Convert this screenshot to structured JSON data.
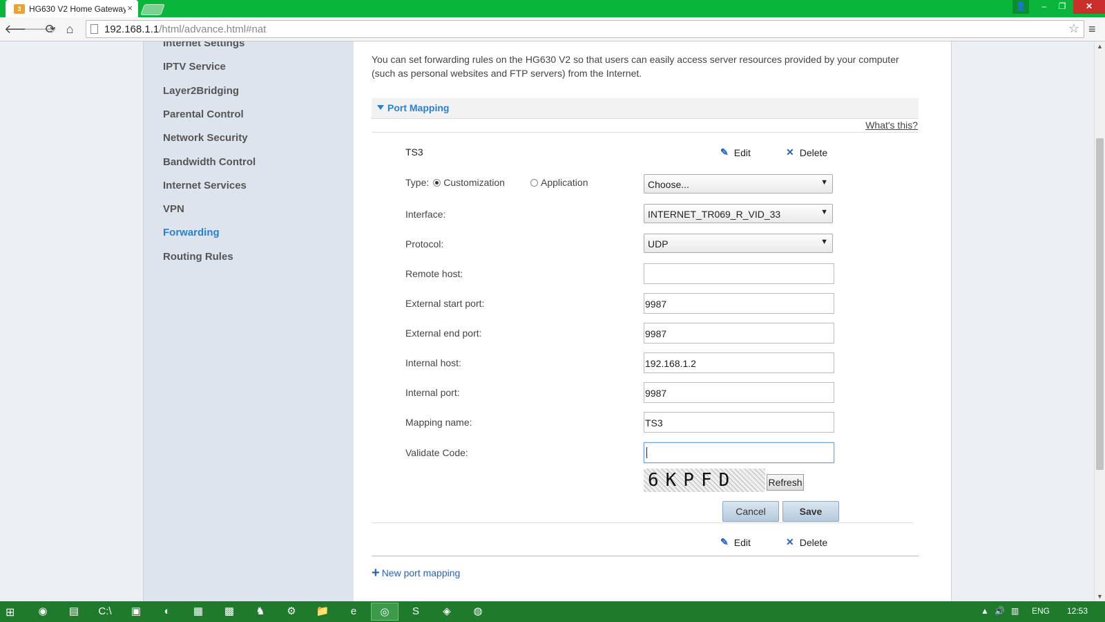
{
  "browser": {
    "tab_title": "HG630 V2 Home Gateway",
    "tab_close": "×",
    "favicon_text": "3",
    "url_host": "192.168.1.1",
    "url_path": "/html/advance.html#nat",
    "back_icon": "🡐",
    "forward_icon": "🡒",
    "reload_icon": "⟳",
    "home_icon": "⌂",
    "star_icon": "☆",
    "menu_icon": "≡",
    "win_user": "👤",
    "win_min": "–",
    "win_max": "❐",
    "win_close": "✕"
  },
  "sidebar": {
    "items": [
      {
        "label": "Internet Settings",
        "active": false
      },
      {
        "label": "IPTV Service",
        "active": false
      },
      {
        "label": "Layer2Bridging",
        "active": false
      },
      {
        "label": "Parental Control",
        "active": false
      },
      {
        "label": "Network Security",
        "active": false
      },
      {
        "label": "Bandwidth Control",
        "active": false
      },
      {
        "label": "Internet Services",
        "active": false
      },
      {
        "label": "VPN",
        "active": false
      },
      {
        "label": "Forwarding",
        "active": true
      },
      {
        "label": "Routing Rules",
        "active": false
      }
    ]
  },
  "main": {
    "intro": "You can set forwarding rules on the HG630 V2 so that users can easily access server resources provided by your computer (such as personal websites and FTP servers) from the Internet.",
    "section_title": "Port Mapping",
    "whats_this": "What's this?",
    "rule_name": "TS3",
    "edit_label": "Edit",
    "delete_label": "Delete",
    "edit_icon": "✎",
    "delete_icon": "✕",
    "form": {
      "type_label": "Type:",
      "type_customization": "Customization",
      "type_application": "Application",
      "type_selected": "Customization",
      "application_select": "Choose...",
      "interface_label": "Interface:",
      "interface_value": "INTERNET_TR069_R_VID_33",
      "protocol_label": "Protocol:",
      "protocol_value": "UDP",
      "remote_host_label": "Remote host:",
      "remote_host_value": "",
      "ext_start_label": "External start port:",
      "ext_start_value": "9987",
      "ext_end_label": "External end port:",
      "ext_end_value": "9987",
      "internal_host_label": "Internal host:",
      "internal_host_value": "192.168.1.2",
      "internal_port_label": "Internal port:",
      "internal_port_value": "9987",
      "mapping_name_label": "Mapping name:",
      "mapping_name_value": "TS3",
      "validate_label": "Validate Code:",
      "validate_value": "",
      "captcha_text": "6KPFD",
      "refresh_label": "Refresh",
      "cancel_label": "Cancel",
      "save_label": "Save",
      "dropdown_arrow": "▼"
    },
    "second_rule": {
      "edit_label": "Edit",
      "delete_label": "Delete"
    },
    "new_mapping_label": "New port mapping",
    "new_mapping_icon": "+"
  },
  "taskbar": {
    "start_icon": "⊞",
    "apps": [
      "◉",
      "▤",
      "C:\\",
      "▣",
      "◐",
      "▦",
      "▩",
      "♞",
      "⚙",
      "📁",
      "e",
      "◎",
      "S",
      "◈",
      "◍"
    ],
    "active_app_index": 11,
    "language": "ENG",
    "clock": "12:53",
    "tray_up": "▲",
    "tray_volume": "🔊",
    "tray_network": "▥"
  },
  "colors": {
    "titlebar": "#0ab53c",
    "accent_link": "#2a7fcf",
    "sidebar_bg": "#dde4ed",
    "taskbar": "#1f7a2c"
  }
}
